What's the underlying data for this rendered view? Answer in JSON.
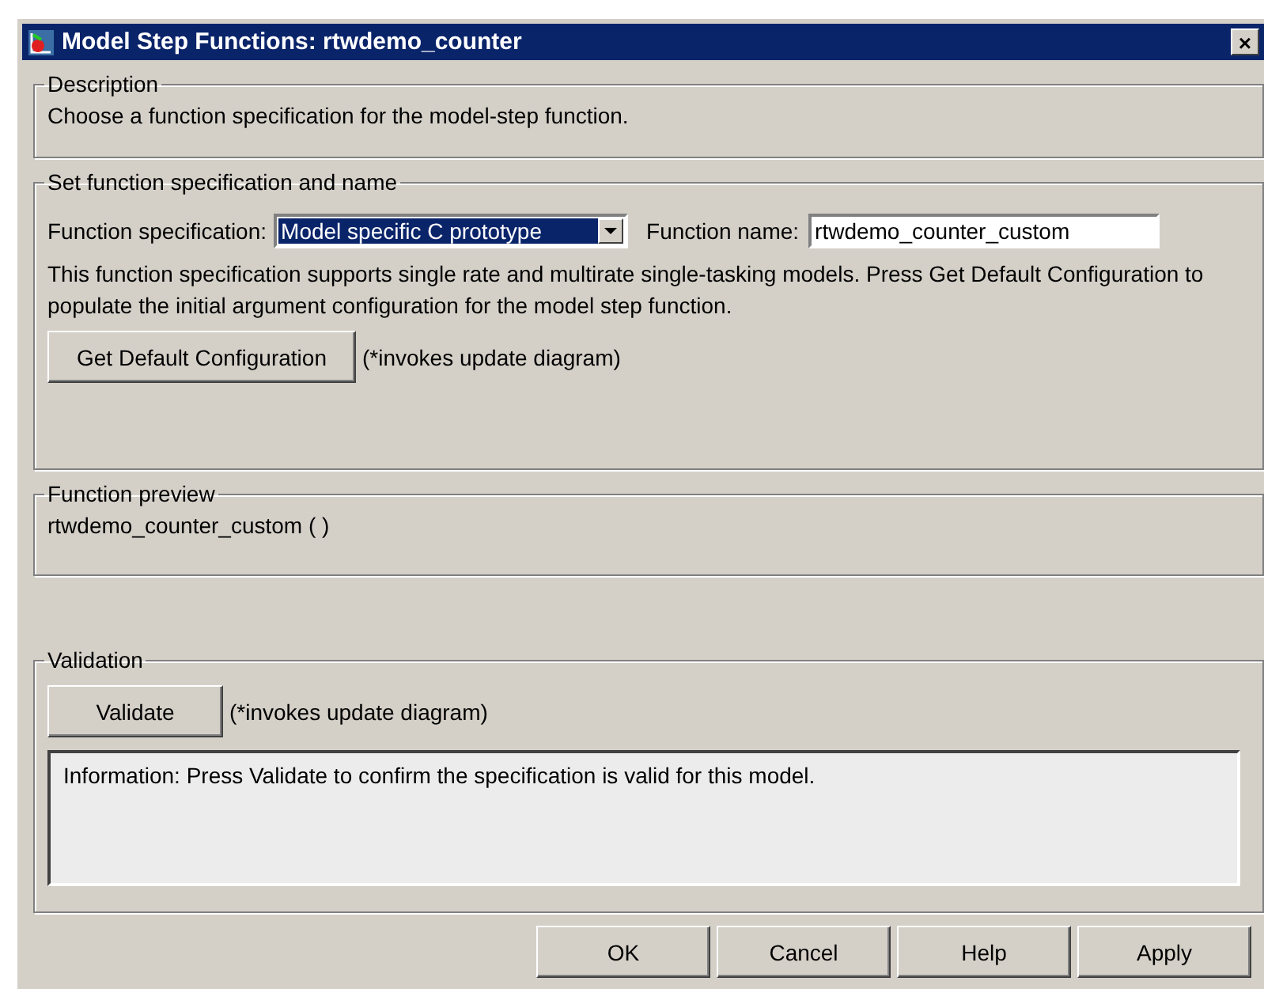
{
  "window": {
    "title": "Model Step Functions: rtwdemo_counter",
    "close": "×"
  },
  "description": {
    "legend": "Description",
    "text": "Choose a function specification for the model-step function."
  },
  "specification": {
    "legend": "Set function specification and name",
    "spec_label": "Function specification:",
    "spec_value": "Model specific C prototype",
    "spec_focused": true,
    "name_label": "Function name:",
    "name_value": "rtwdemo_counter_custom",
    "help": "This function specification supports single rate and multirate single-tasking models.  Press Get Default Configuration to populate the initial argument configuration for the model step function.",
    "button": "Get Default Configuration",
    "note": "(*invokes update diagram)"
  },
  "preview": {
    "legend": "Function preview",
    "text": "rtwdemo_counter_custom ( )"
  },
  "validation": {
    "legend": "Validation",
    "button": "Validate",
    "note": "(*invokes update diagram)",
    "info": "Information: Press Validate to confirm the specification is valid for this model."
  },
  "buttons": [
    "OK",
    "Cancel",
    "Help",
    "Apply"
  ]
}
